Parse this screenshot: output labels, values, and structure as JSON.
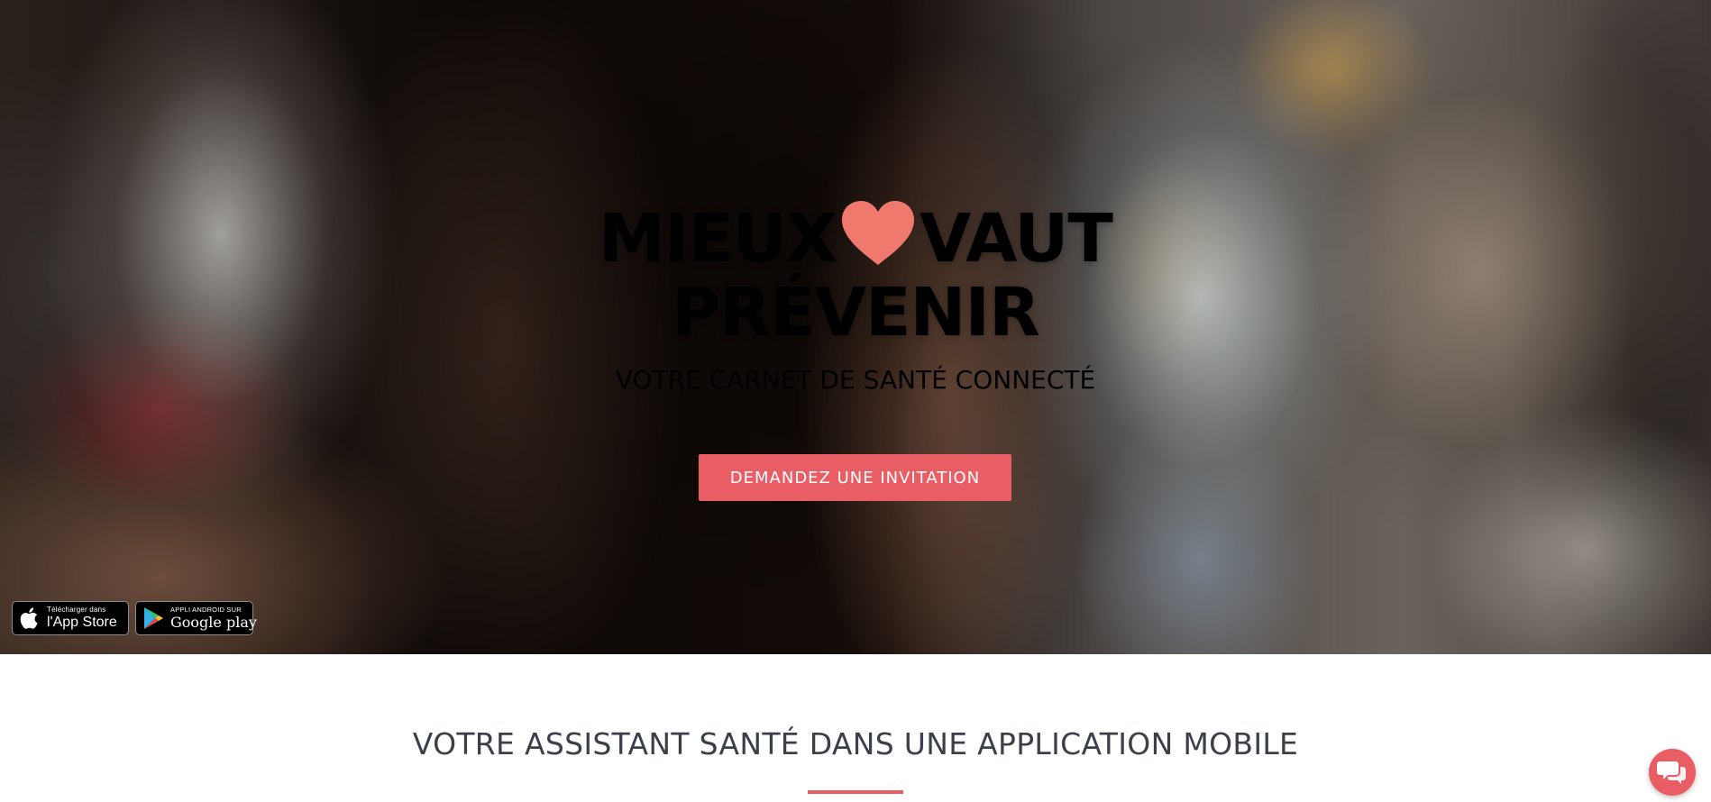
{
  "hero": {
    "headline_line1_left": "MIEUX",
    "headline_line1_right": "VAUT",
    "headline_line2": "PRÉVENIR",
    "heart_icon": "heart-icon",
    "subtitle": "VOTRE CARNET DE SANTÉ CONNECTÉ",
    "cta_label": "DEMANDEZ UNE INVITATION"
  },
  "badges": {
    "appstore": {
      "small": "Télécharger dans",
      "big": "l'App Store",
      "icon": "apple-icon"
    },
    "googleplay": {
      "small": "APPLI ANDROID SUR",
      "big": "Google play",
      "icon": "google-play-icon"
    }
  },
  "section": {
    "title": "VOTRE ASSISTANT SANTÉ DANS UNE APPLICATION MOBILE"
  },
  "chat": {
    "icon": "chat-icon"
  },
  "colors": {
    "accent": "#e95d64",
    "heading": "#3a3f4a",
    "heart": "#f0796e"
  }
}
